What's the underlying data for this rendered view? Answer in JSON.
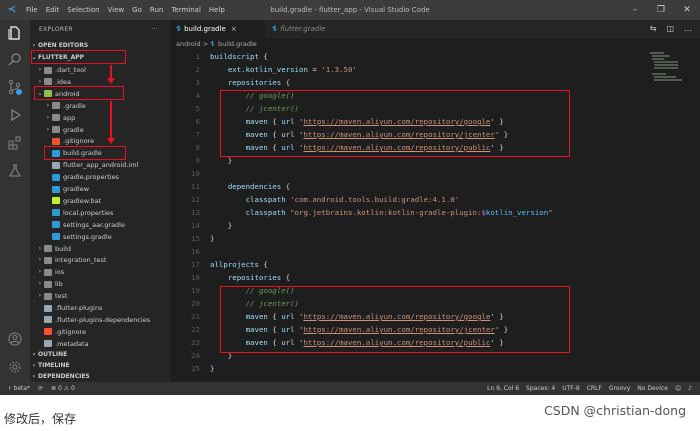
{
  "titlebar": {
    "menu": [
      "File",
      "Edit",
      "Selection",
      "View",
      "Go",
      "Run",
      "Terminal",
      "Help"
    ],
    "title": "build.gradle - flutter_app - Visual Studio Code"
  },
  "sidebar": {
    "header": "EXPLORER",
    "header_more": "···",
    "open_editors": "OPEN EDITORS",
    "root": "FLUTTER_APP",
    "items": [
      {
        "label": ".dart_tool",
        "kind": "folder"
      },
      {
        "label": ".idea",
        "kind": "folder"
      },
      {
        "label": "android",
        "kind": "folder-android"
      },
      {
        "label": ".gradle",
        "kind": "folder"
      },
      {
        "label": "app",
        "kind": "folder"
      },
      {
        "label": "gradle",
        "kind": "folder"
      },
      {
        "label": ".gitignore",
        "kind": "git"
      },
      {
        "label": "build.gradle",
        "kind": "gradle"
      },
      {
        "label": "flutter_app_android.iml",
        "kind": "file"
      },
      {
        "label": "gradle.properties",
        "kind": "gradle"
      },
      {
        "label": "gradlew",
        "kind": "gradle"
      },
      {
        "label": "gradlew.bat",
        "kind": "bat"
      },
      {
        "label": "local.properties",
        "kind": "gear"
      },
      {
        "label": "settings_aar.gradle",
        "kind": "gradle"
      },
      {
        "label": "settings.gradle",
        "kind": "gradle"
      },
      {
        "label": "build",
        "kind": "folder"
      },
      {
        "label": "integration_test",
        "kind": "folder"
      },
      {
        "label": "ios",
        "kind": "folder"
      },
      {
        "label": "lib",
        "kind": "folder"
      },
      {
        "label": "test",
        "kind": "folder"
      },
      {
        "label": ".flutter-plugins",
        "kind": "file"
      },
      {
        "label": ".flutter-plugins-dependencies",
        "kind": "file"
      },
      {
        "label": ".gitignore",
        "kind": "git"
      },
      {
        "label": ".metadata",
        "kind": "file"
      }
    ],
    "outline": "OUTLINE",
    "timeline": "TIMELINE",
    "dependencies": "DEPENDENCIES"
  },
  "tabs": [
    {
      "label": "build.gradle",
      "active": true,
      "close": "×"
    },
    {
      "label": "flutter.gradle",
      "active": false
    }
  ],
  "breadcrumb": {
    "folder": "android",
    "sep": ">",
    "file": "build.gradle"
  },
  "editor": {
    "lines": [
      {
        "n": "1",
        "t": "buildscript {"
      },
      {
        "n": "2",
        "t": "    ext.kotlin_version = '1.3.50'"
      },
      {
        "n": "3",
        "t": "    repositories {"
      },
      {
        "n": "4",
        "t": "        // google()"
      },
      {
        "n": "5",
        "t": "        // jcenter()"
      },
      {
        "n": "6",
        "t": "        maven { url 'https://maven.aliyun.com/repository/google' }"
      },
      {
        "n": "7",
        "t": "        maven { url 'https://maven.aliyun.com/repository/jcenter' }"
      },
      {
        "n": "8",
        "t": "        maven { url 'https://maven.aliyun.com/repository/public' }"
      },
      {
        "n": "9",
        "t": "    }"
      },
      {
        "n": "10",
        "t": ""
      },
      {
        "n": "11",
        "t": "    dependencies {"
      },
      {
        "n": "12",
        "t": "        classpath 'com.android.tools.build:gradle:4.1.0'"
      },
      {
        "n": "13",
        "t": "        classpath \"org.jetbrains.kotlin:kotlin-gradle-plugin:$kotlin_version\""
      },
      {
        "n": "14",
        "t": "    }"
      },
      {
        "n": "15",
        "t": "}"
      },
      {
        "n": "16",
        "t": ""
      },
      {
        "n": "17",
        "t": "allprojects {"
      },
      {
        "n": "18",
        "t": "    repositories {"
      },
      {
        "n": "19",
        "t": "        // google()"
      },
      {
        "n": "20",
        "t": "        // jcenter()"
      },
      {
        "n": "21",
        "t": "        maven { url 'https://maven.aliyun.com/repository/google' }"
      },
      {
        "n": "22",
        "t": "        maven { url 'https://maven.aliyun.com/repository/jcenter' }"
      },
      {
        "n": "23",
        "t": "        maven { url 'https://maven.aliyun.com/repository/public' }"
      },
      {
        "n": "24",
        "t": "    }"
      },
      {
        "n": "25",
        "t": "}"
      }
    ]
  },
  "statusbar": {
    "branch": "beta*",
    "sync": "⟳",
    "problems": "⊗ 0 ⚠ 0",
    "position": "Ln 9, Col 6",
    "spaces": "Spaces: 4",
    "encoding": "UTF-8",
    "eol": "CRLF",
    "language": "Groovy",
    "device": "No Device"
  },
  "caption": "修改后，保存",
  "watermark": "CSDN @christian-dong",
  "colors": {
    "highlight": "#e81123",
    "accent": "#3c9be8",
    "statusbar": "#333333"
  }
}
